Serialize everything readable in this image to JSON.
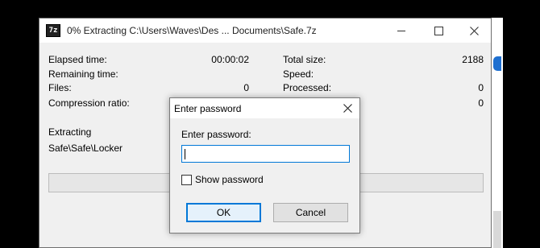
{
  "window": {
    "title": "0% Extracting C:\\Users\\Waves\\Des ...  Documents\\Safe.7z",
    "app_icon_text": "7z"
  },
  "stats_left": [
    {
      "label": "Elapsed time:",
      "value": "00:00:02"
    },
    {
      "label": "Remaining time:",
      "value": ""
    },
    {
      "label": "Files:",
      "value": "0"
    },
    {
      "label": "Compression ratio:",
      "value": ""
    }
  ],
  "stats_right": [
    {
      "label": "Total size:",
      "value": "2188"
    },
    {
      "label": "Speed:",
      "value": ""
    },
    {
      "label": "Processed:",
      "value": "0"
    },
    {
      "label": "",
      "value": "0"
    }
  ],
  "operation": {
    "label": "Extracting",
    "path": "Safe\\Safe\\Locker"
  },
  "progress": {
    "fraction": 0.0
  },
  "dialog": {
    "title": "Enter password",
    "prompt": "Enter password:",
    "password_value": "",
    "show_password_label": "Show password",
    "show_password_checked": false,
    "ok_label": "OK",
    "cancel_label": "Cancel"
  },
  "icons": {
    "app": "7zip-app-icon",
    "close": "close-icon",
    "minimize": "minimize-icon",
    "maximize": "maximize-icon"
  }
}
